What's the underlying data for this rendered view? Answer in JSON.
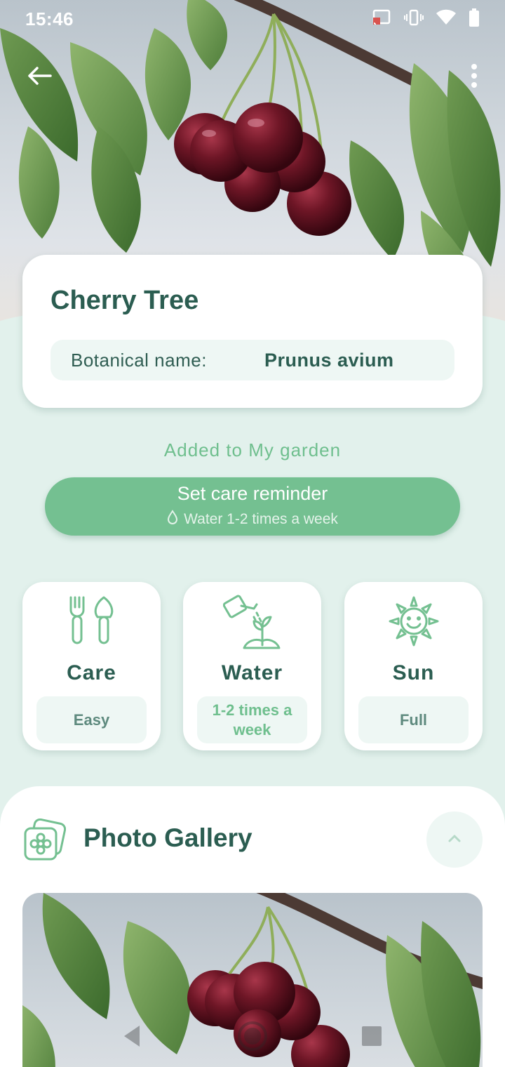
{
  "status_bar": {
    "time": "15:46",
    "icons": [
      "cast-icon",
      "vibrate-icon",
      "wifi-icon",
      "battery-icon"
    ]
  },
  "top_bar": {
    "back_icon": "arrow-left-icon",
    "menu_icon": "more-vertical-icon"
  },
  "plant": {
    "name": "Cherry Tree",
    "botanical_label": "Botanical name:",
    "botanical_value": "Prunus avium",
    "hero_image": "cherries-on-branch"
  },
  "garden": {
    "status": "Added to My garden",
    "reminder_title": "Set care reminder",
    "reminder_subtitle": "Water 1-2 times a week",
    "reminder_icon": "water-drop-icon"
  },
  "info_cards": [
    {
      "icon": "garden-tools-icon",
      "title": "Care",
      "value": "Easy"
    },
    {
      "icon": "watering-can-icon",
      "title": "Water",
      "value": "1-2 times a week"
    },
    {
      "icon": "sun-icon",
      "title": "Sun",
      "value": "Full"
    }
  ],
  "gallery": {
    "icon": "photo-flower-icon",
    "title": "Photo Gallery",
    "toggle_icon": "chevron-up-icon"
  },
  "colors": {
    "background": "#e2f1ec",
    "accent": "#74c091",
    "text_dark": "#2b5d51"
  }
}
